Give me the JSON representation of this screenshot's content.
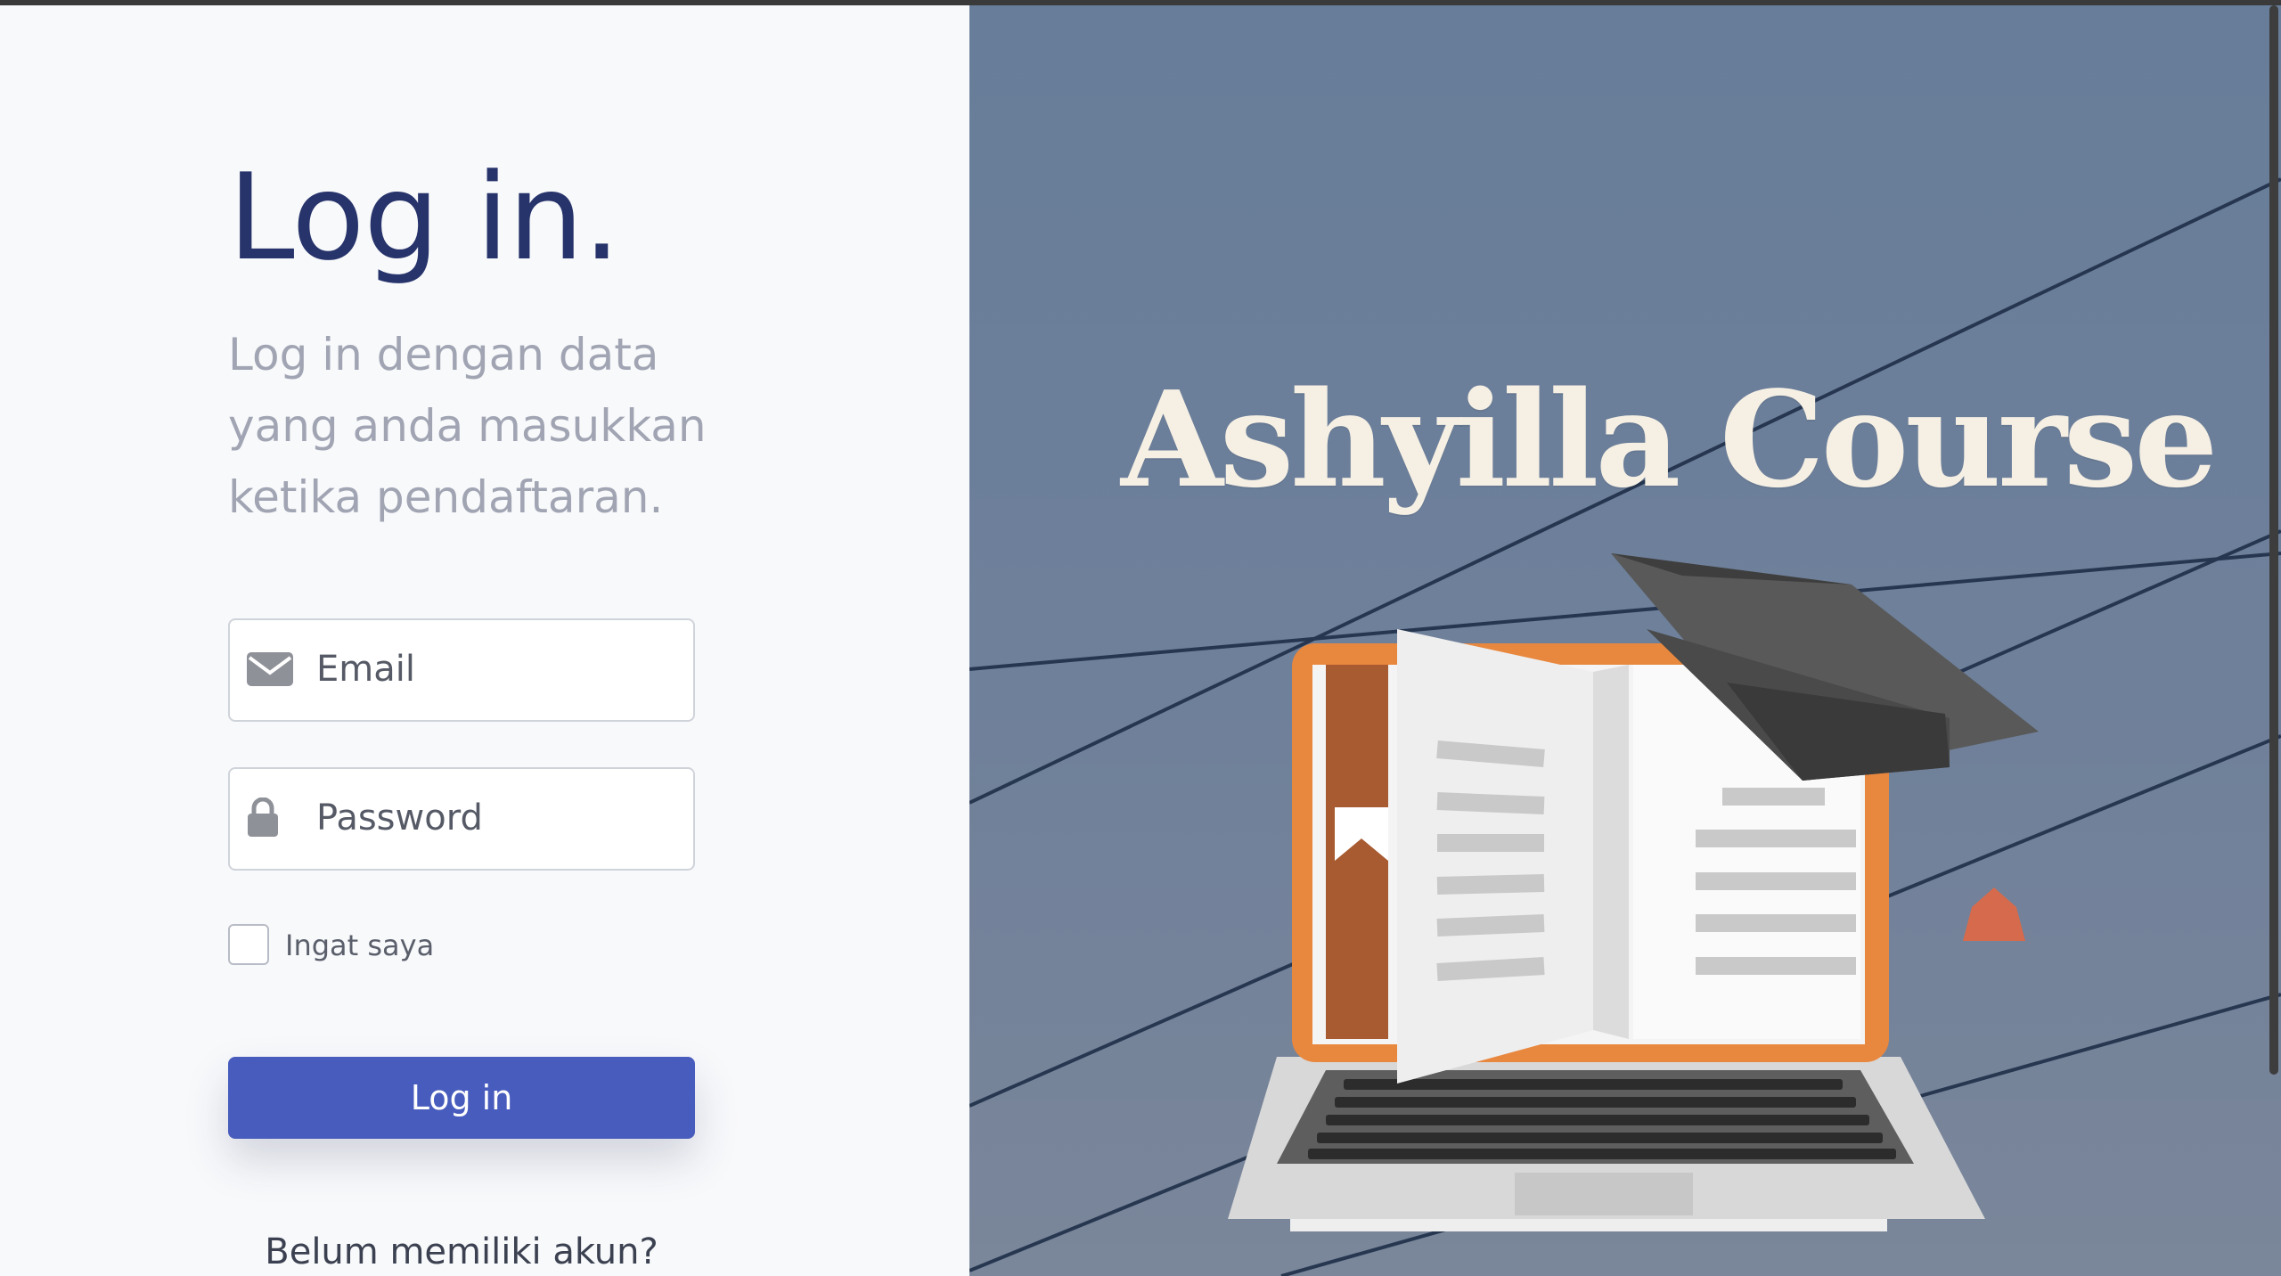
{
  "login": {
    "title": "Log in.",
    "subtitle": "Log in dengan data yang anda masukkan ketika pendaftaran.",
    "email_placeholder": "Email",
    "password_placeholder": "Password",
    "remember_label": "Ingat saya",
    "button_label": "Log in",
    "signup_prompt": "Belum memiliki akun?"
  },
  "brand": {
    "name": "Ashyilla Course"
  },
  "icons": {
    "email": "envelope-icon",
    "password": "lock-icon"
  },
  "colors": {
    "title": "#27346b",
    "button": "#485cbd",
    "hero_bg": "#6f809a",
    "brand_text": "#f6f0e4",
    "laptop_frame": "#e8873e"
  }
}
